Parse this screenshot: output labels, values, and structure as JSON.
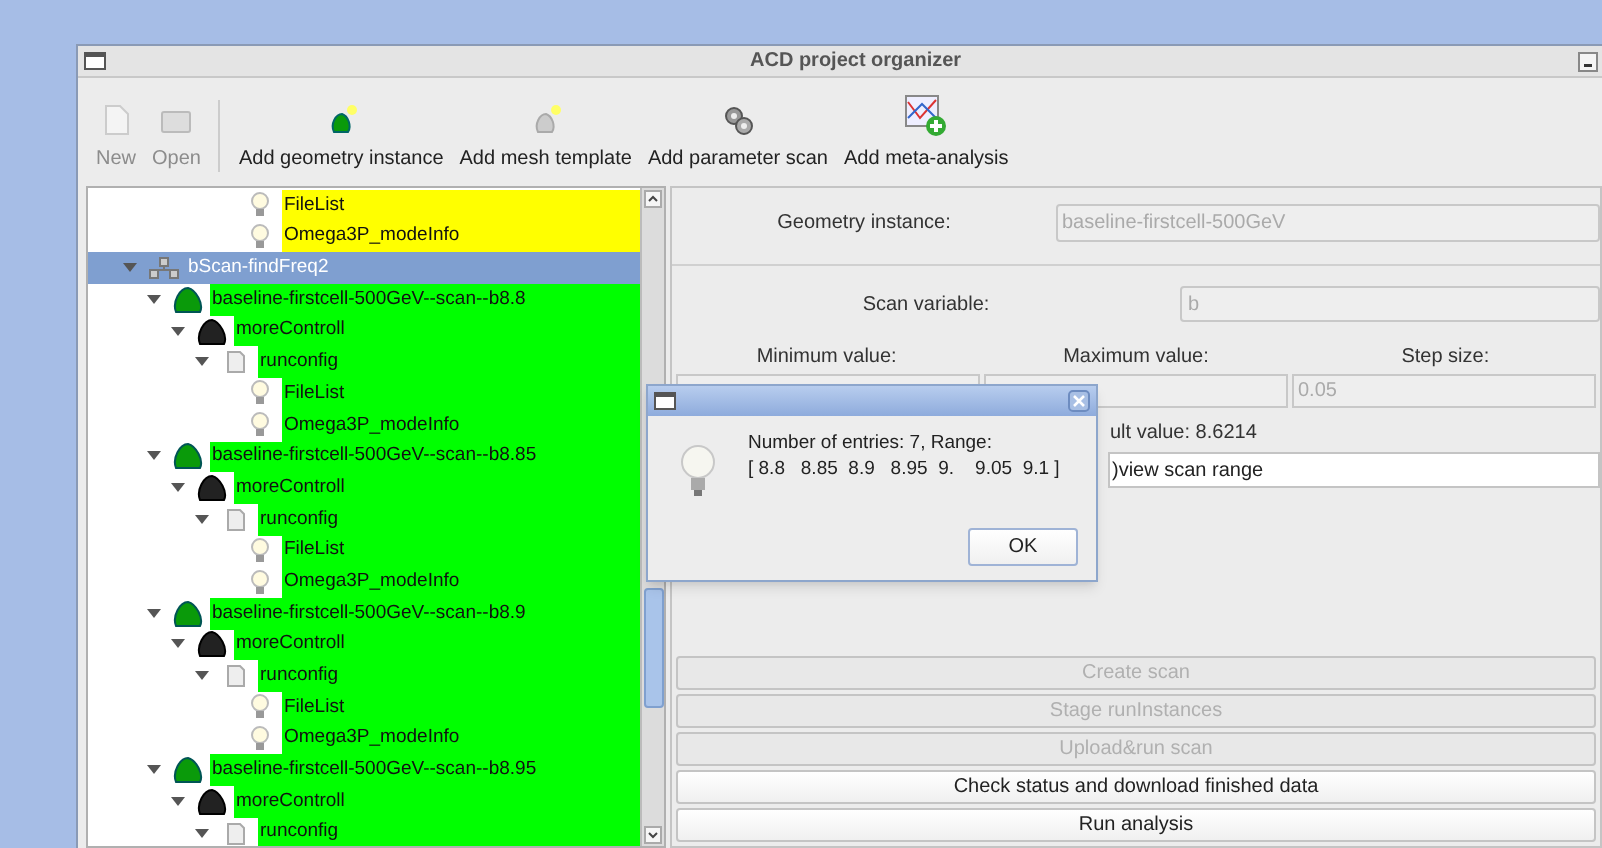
{
  "window": {
    "title": "ACD project organizer"
  },
  "toolbar": [
    {
      "label": "New",
      "kind": "new",
      "disabled": true
    },
    {
      "label": "Open",
      "kind": "open",
      "disabled": true
    },
    {
      "label": "Add geometry instance",
      "kind": "geometry",
      "disabled": false
    },
    {
      "label": "Add mesh template",
      "kind": "mesh",
      "disabled": false
    },
    {
      "label": "Add parameter scan",
      "kind": "scan",
      "disabled": false
    },
    {
      "label": "Add meta-analysis",
      "kind": "meta",
      "disabled": false
    }
  ],
  "tree": {
    "items": [
      {
        "children": [
          {
            "children": [
              {
                "children": [
                  {
                    "children": [
                      {
                        "label": "FileList",
                        "kind": "file",
                        "color": "#ffff00",
                        "selected": false
                      },
                      {
                        "label": "Omega3P_modeInfo",
                        "kind": "file",
                        "color": "#ffff00",
                        "selected": false
                      }
                    ]
                  }
                ]
              }
            ]
          }
        ]
      },
      {
        "label": "bScan-findFreq2",
        "kind": "scan",
        "selected": true,
        "expanded": true,
        "children": [
          {
            "label": "baseline-firstcell-500GeV--scan--b8.8",
            "kind": "geometry",
            "color": "#00ff00",
            "selected": false,
            "expanded": true,
            "children": [
              {
                "label": "moreControll",
                "kind": "mesh",
                "color": "#00ff00",
                "selected": false,
                "expanded": true,
                "children": [
                  {
                    "label": "runconfig",
                    "kind": "runconfig",
                    "color": "#00ff00",
                    "selected": false,
                    "expanded": true,
                    "children": [
                      {
                        "label": "FileList",
                        "kind": "file",
                        "color": "#00ff00",
                        "selected": false
                      },
                      {
                        "label": "Omega3P_modeInfo",
                        "kind": "file",
                        "color": "#00ff00",
                        "selected": false
                      }
                    ]
                  }
                ]
              }
            ]
          },
          {
            "label": "baseline-firstcell-500GeV--scan--b8.85",
            "kind": "geometry",
            "color": "#00ff00",
            "selected": false,
            "expanded": true,
            "children": [
              {
                "label": "moreControll",
                "kind": "mesh",
                "color": "#00ff00",
                "selected": false,
                "expanded": true,
                "children": [
                  {
                    "label": "runconfig",
                    "kind": "runconfig",
                    "color": "#00ff00",
                    "selected": false,
                    "expanded": true,
                    "children": [
                      {
                        "label": "FileList",
                        "kind": "file",
                        "color": "#00ff00",
                        "selected": false
                      },
                      {
                        "label": "Omega3P_modeInfo",
                        "kind": "file",
                        "color": "#00ff00",
                        "selected": false
                      }
                    ]
                  }
                ]
              }
            ]
          },
          {
            "label": "baseline-firstcell-500GeV--scan--b8.9",
            "kind": "geometry",
            "color": "#00ff00",
            "selected": false,
            "expanded": true,
            "children": [
              {
                "label": "moreControll",
                "kind": "mesh",
                "color": "#00ff00",
                "selected": false,
                "expanded": true,
                "children": [
                  {
                    "label": "runconfig",
                    "kind": "runconfig",
                    "color": "#00ff00",
                    "selected": false,
                    "expanded": true,
                    "children": [
                      {
                        "label": "FileList",
                        "kind": "file",
                        "color": "#00ff00",
                        "selected": false
                      },
                      {
                        "label": "Omega3P_modeInfo",
                        "kind": "file",
                        "color": "#00ff00",
                        "selected": false
                      }
                    ]
                  }
                ]
              }
            ]
          },
          {
            "label": "baseline-firstcell-500GeV--scan--b8.95",
            "kind": "geometry",
            "color": "#00ff00",
            "selected": false,
            "expanded": true,
            "children": [
              {
                "label": "moreControll",
                "kind": "mesh",
                "color": "#00ff00",
                "selected": false,
                "expanded": true,
                "children": [
                  {
                    "label": "runconfig",
                    "kind": "runconfig",
                    "color": "#00ff00",
                    "selected": false,
                    "expanded": true
                  }
                ]
              }
            ]
          }
        ]
      }
    ]
  },
  "form": {
    "geometry_label": "Geometry instance:",
    "geometry_value": "baseline-firstcell-500GeV",
    "scan_variable_label": "Scan variable:",
    "scan_variable_value": "b",
    "columns": [
      {
        "label": "Minimum value:"
      },
      {
        "label": "Maximum value:"
      },
      {
        "label": "Step size:",
        "value": "0.05"
      }
    ],
    "default_value": "ult value: 8.6214",
    "preview_button": ")view scan range"
  },
  "buttons": [
    {
      "label": "Create scan",
      "disabled": true
    },
    {
      "label": "Stage runInstances",
      "disabled": true
    },
    {
      "label": "Upload&run scan",
      "disabled": true
    },
    {
      "label": "Check status and download finished data",
      "disabled": false
    },
    {
      "label": "Run analysis",
      "disabled": false
    }
  ],
  "dialog": {
    "lines": [
      "Number of entries: 7, Range:",
      "[ 8.8   8.85  8.9   8.95  9.    9.05  9.1 ]"
    ],
    "ok": "OK"
  }
}
